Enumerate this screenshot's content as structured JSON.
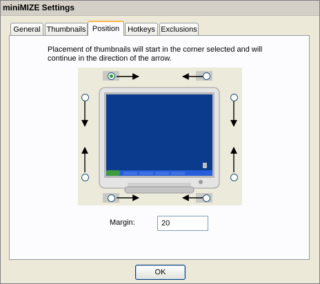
{
  "window": {
    "title": "miniMIZE Settings"
  },
  "tabs": [
    {
      "label": "General",
      "active": false
    },
    {
      "label": "Thumbnails",
      "active": false
    },
    {
      "label": "Position",
      "active": true
    },
    {
      "label": "Hotkeys",
      "active": false
    },
    {
      "label": "Exclusions",
      "active": false
    }
  ],
  "position": {
    "description": "Placement of thumbnails will start in the corner selected and will continue in the direction of the arrow.",
    "selected_option": "top-left-horizontal",
    "options": [
      "top-left-horizontal",
      "top-right-horizontal",
      "top-left-vertical",
      "top-right-vertical",
      "bottom-left-vertical",
      "bottom-right-vertical",
      "bottom-left-horizontal",
      "bottom-right-horizontal"
    ],
    "margin_label": "Margin:",
    "margin_value": "20"
  },
  "footer": {
    "ok_label": "OK"
  },
  "colors": {
    "screen": "#0a3b8c",
    "taskbar": "#245edb",
    "start_button": "#3c9c3c",
    "radio_checked": "#21a121"
  }
}
